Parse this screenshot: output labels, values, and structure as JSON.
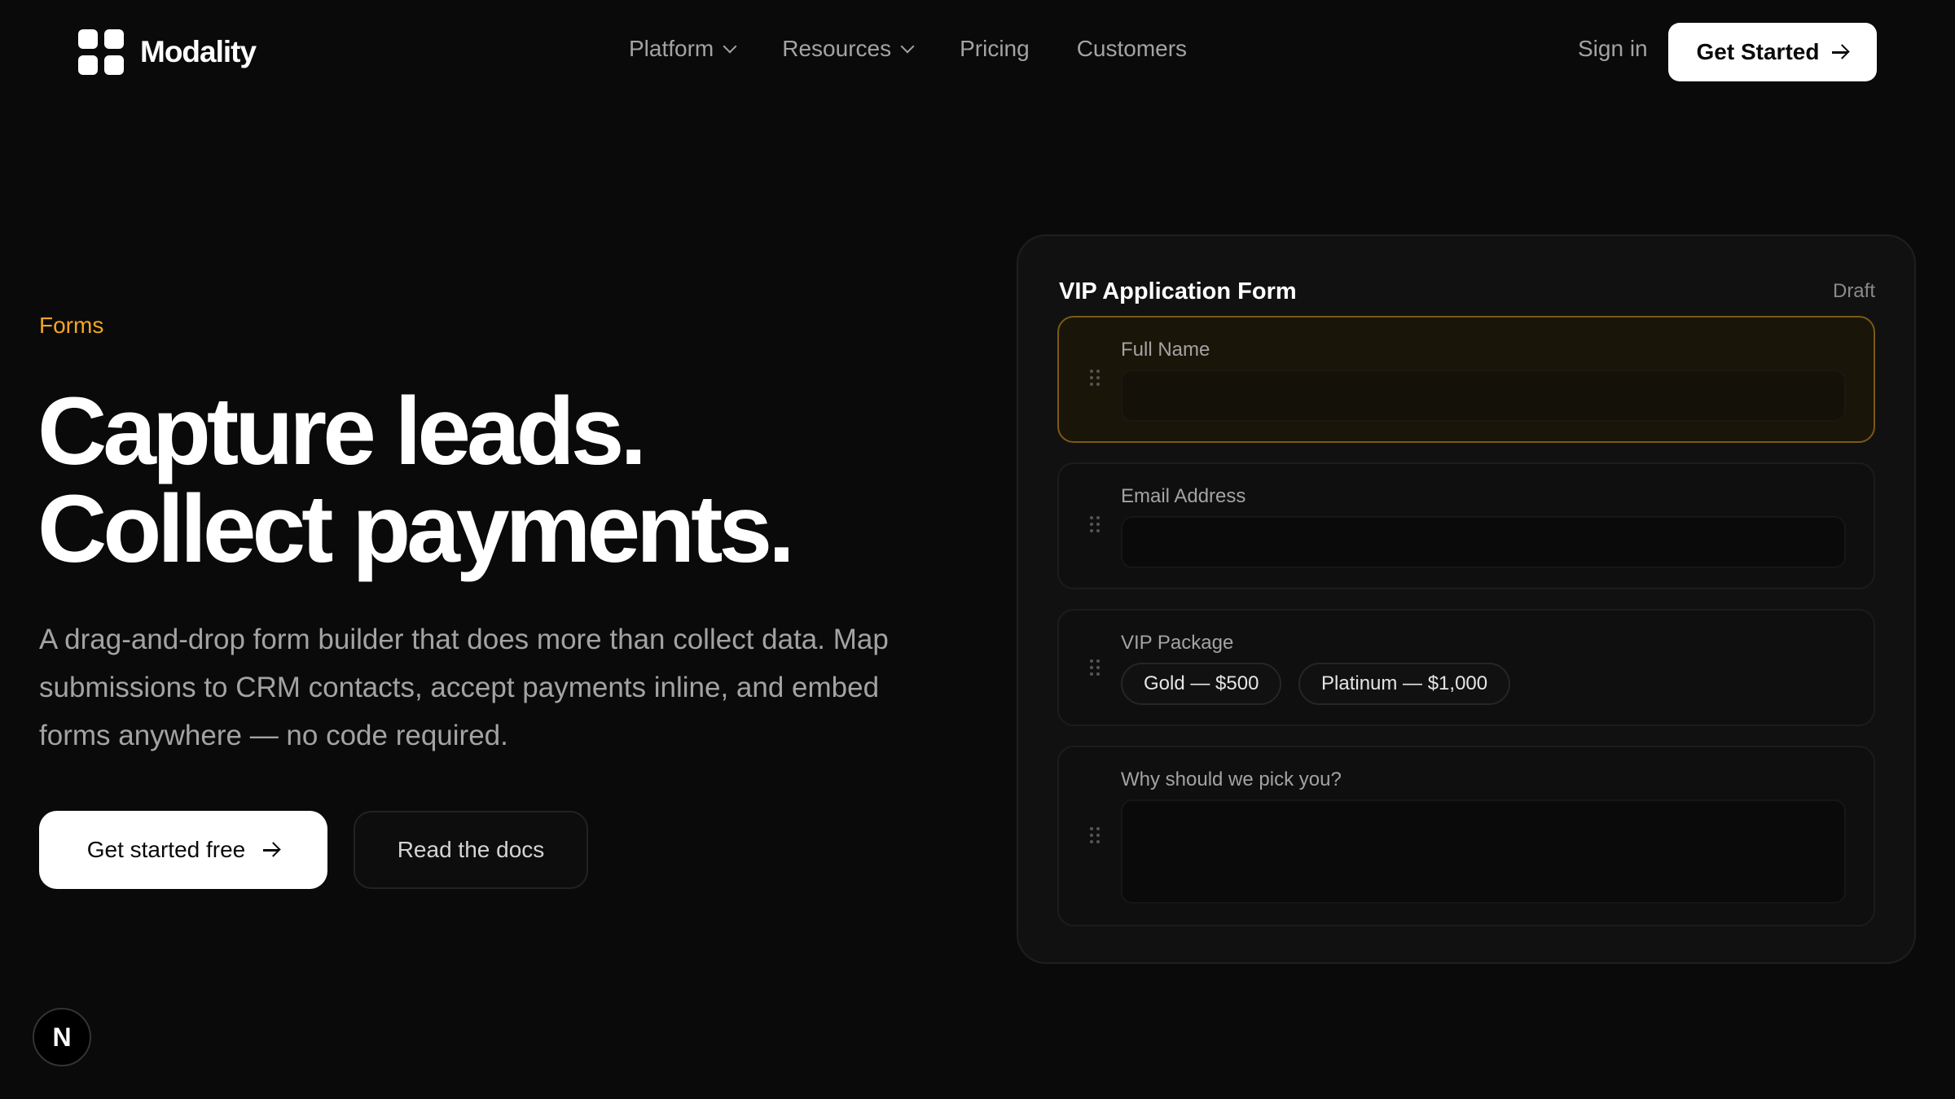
{
  "nav": {
    "brand": "Modality",
    "links": [
      {
        "label": "Platform",
        "has_dropdown": true
      },
      {
        "label": "Resources",
        "has_dropdown": true
      },
      {
        "label": "Pricing",
        "has_dropdown": false
      },
      {
        "label": "Customers",
        "has_dropdown": false
      }
    ],
    "sign_in": "Sign in",
    "cta": "Get Started"
  },
  "hero": {
    "eyebrow": "Forms",
    "headline_line1": "Capture leads.",
    "headline_line2": "Collect payments.",
    "description": "A drag-and-drop form builder that does more than collect data. Map submissions to CRM contacts, accept payments inline, and embed forms anywhere — no code required.",
    "primary_button": "Get started free",
    "secondary_button": "Read the docs"
  },
  "form_preview": {
    "title": "VIP Application Form",
    "status": "Draft",
    "fields": {
      "full_name": {
        "label": "Full Name",
        "value": ""
      },
      "email": {
        "label": "Email Address",
        "value": ""
      },
      "package": {
        "label": "VIP Package",
        "options": [
          "Gold — $500",
          "Platinum — $1,000"
        ]
      },
      "reason": {
        "label": "Why should we pick you?",
        "value": ""
      }
    }
  },
  "badge": {
    "letter": "N"
  },
  "colors": {
    "background": "#0a0a0a",
    "accent": "#f5a524",
    "card": "#111111",
    "text_muted": "#a3a3a3"
  }
}
